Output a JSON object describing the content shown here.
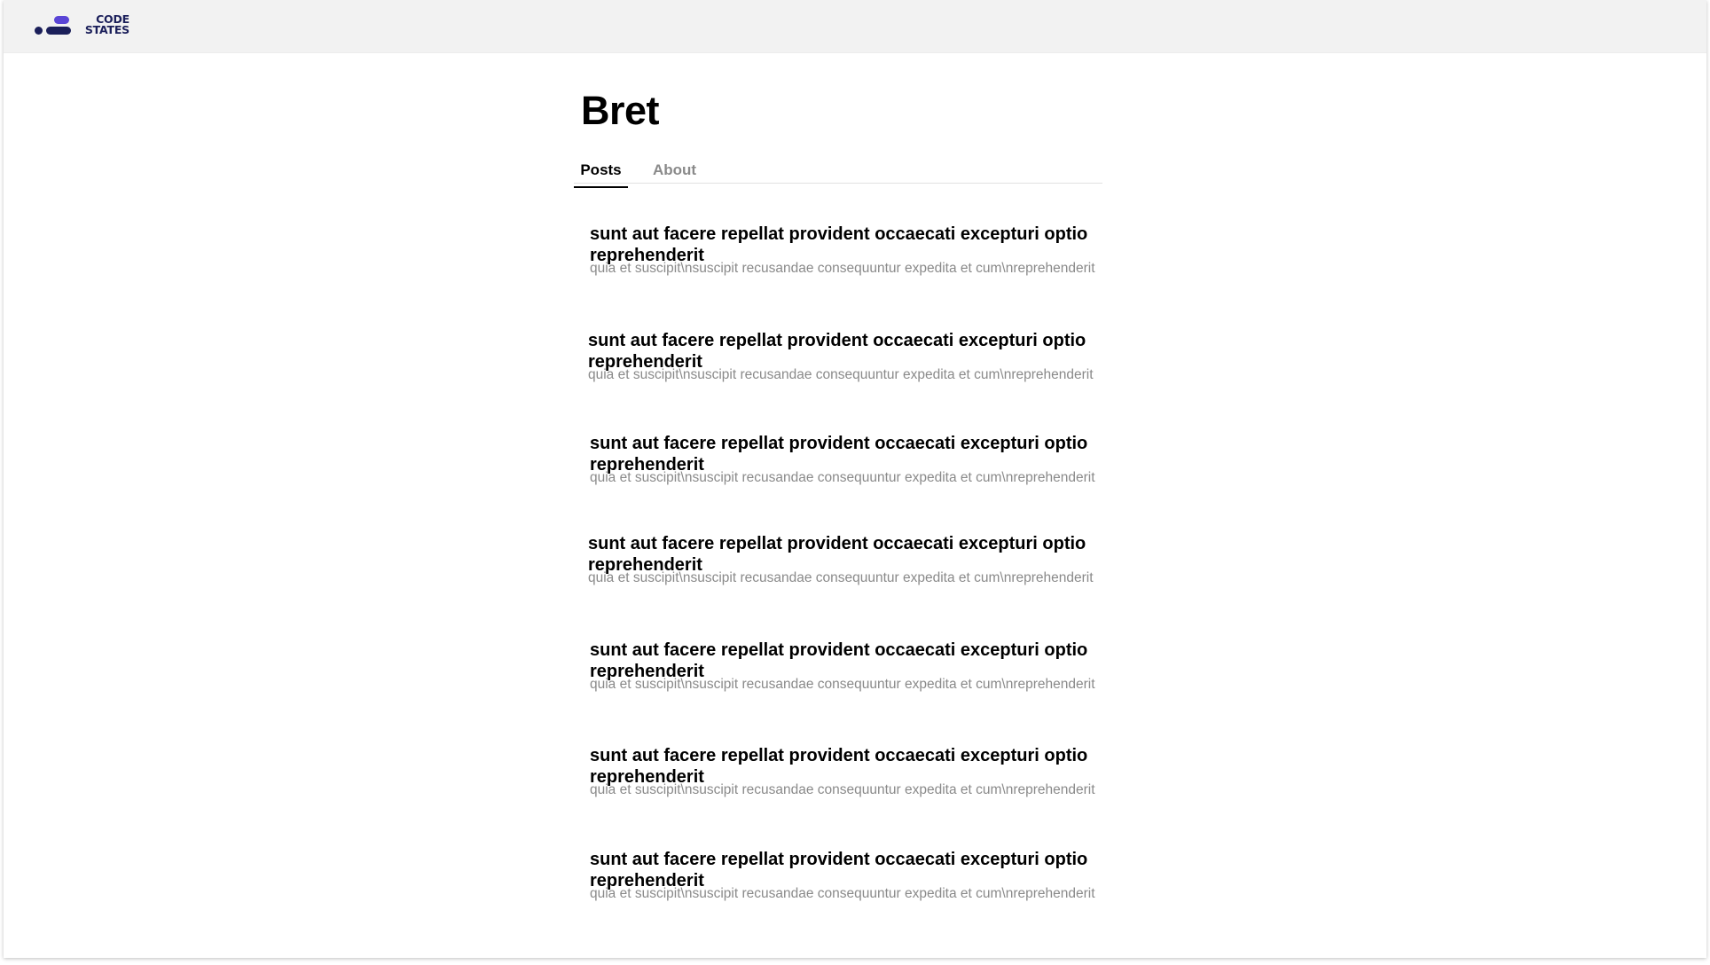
{
  "header": {
    "logo_line1": "CODE",
    "logo_line2": "STATES",
    "colors": {
      "logo_dark": "#1b1f5a",
      "logo_accent": "#5a45d6",
      "background": "#f2f2f2"
    }
  },
  "profile": {
    "username": "Bret"
  },
  "tabs": [
    {
      "label": "Posts",
      "active": true
    },
    {
      "label": "About",
      "active": false
    }
  ],
  "posts": [
    {
      "title": "sunt aut facere repellat provident occaecati excepturi optio reprehenderit",
      "body": "quia et suscipit\\nsuscipit recusandae consequuntur expedita et cum\\nreprehenderit"
    },
    {
      "title": "sunt aut facere repellat provident occaecati excepturi optio reprehenderit",
      "body": "quia et suscipit\\nsuscipit recusandae consequuntur expedita et cum\\nreprehenderit"
    },
    {
      "title": "sunt aut facere repellat provident occaecati excepturi optio reprehenderit",
      "body": "quia et suscipit\\nsuscipit recusandae consequuntur expedita et cum\\nreprehenderit"
    },
    {
      "title": "sunt aut facere repellat provident occaecati excepturi optio reprehenderit",
      "body": "quia et suscipit\\nsuscipit recusandae consequuntur expedita et cum\\nreprehenderit"
    },
    {
      "title": "sunt aut facere repellat provident occaecati excepturi optio reprehenderit",
      "body": "quia et suscipit\\nsuscipit recusandae consequuntur expedita et cum\\nreprehenderit"
    },
    {
      "title": "sunt aut facere repellat provident occaecati excepturi optio reprehenderit",
      "body": "quia et suscipit\\nsuscipit recusandae consequuntur expedita et cum\\nreprehenderit"
    },
    {
      "title": "sunt aut facere repellat provident occaecati excepturi optio reprehenderit",
      "body": "quia et suscipit\\nsuscipit recusandae consequuntur expedita et cum\\nreprehenderit"
    }
  ]
}
